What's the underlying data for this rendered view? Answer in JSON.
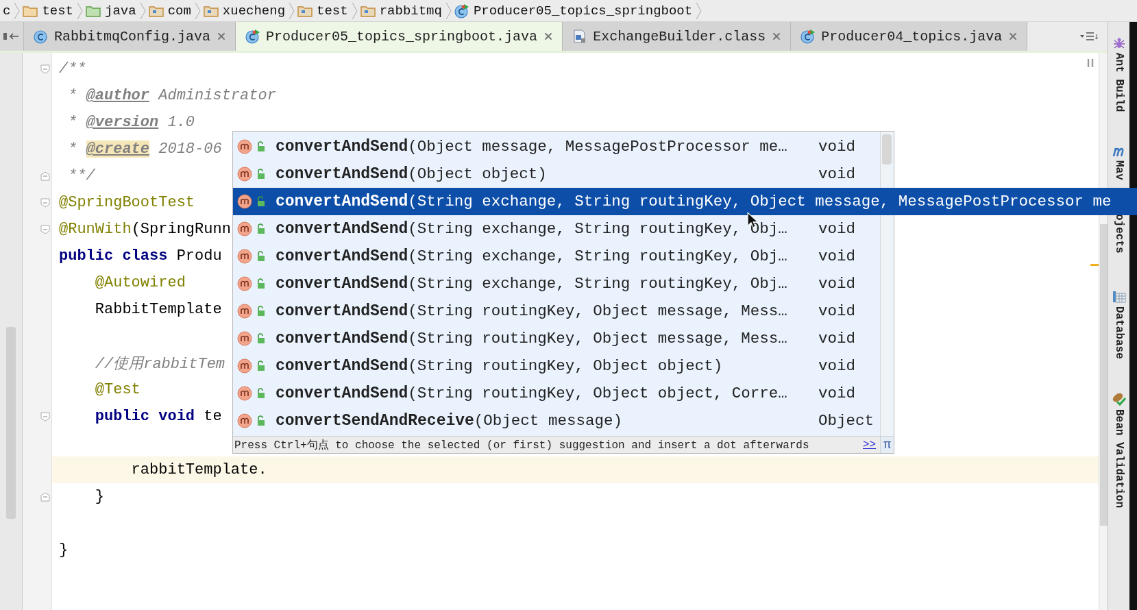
{
  "breadcrumbs": [
    {
      "label": "c",
      "kind": "none"
    },
    {
      "label": "test",
      "kind": "folder"
    },
    {
      "label": "java",
      "kind": "source"
    },
    {
      "label": "com",
      "kind": "package"
    },
    {
      "label": "xuecheng",
      "kind": "package"
    },
    {
      "label": "test",
      "kind": "package"
    },
    {
      "label": "rabbitmq",
      "kind": "package"
    },
    {
      "label": "Producer05_topics_springboot",
      "kind": "runnable"
    }
  ],
  "tabs": [
    {
      "label": "RabbitmqConfig.java",
      "kind": "class",
      "selected": false
    },
    {
      "label": "Producer05_topics_springboot.java",
      "kind": "runnable",
      "selected": true
    },
    {
      "label": "ExchangeBuilder.class",
      "kind": "compiled",
      "selected": false
    },
    {
      "label": "Producer04_topics.java",
      "kind": "runnable",
      "selected": false
    }
  ],
  "code_lines": [
    {
      "kind": "code",
      "fold_start": true,
      "tokens": [
        {
          "kind": "comment",
          "text": "/**"
        }
      ]
    },
    {
      "kind": "code",
      "tokens": [
        {
          "kind": "comment",
          "text": " * "
        },
        {
          "kind": "doctag",
          "text": "@author"
        },
        {
          "kind": "comment",
          "text": " Administrator"
        }
      ]
    },
    {
      "kind": "code",
      "tokens": [
        {
          "kind": "comment",
          "text": " * "
        },
        {
          "kind": "doctag",
          "text": "@version"
        },
        {
          "kind": "comment",
          "text": " 1.0"
        }
      ]
    },
    {
      "kind": "code",
      "tokens": [
        {
          "kind": "comment",
          "text": " * "
        },
        {
          "kind": "doctag",
          "text": "@create",
          "highlighted": true
        },
        {
          "kind": "comment",
          "text": " 2018-06"
        }
      ]
    },
    {
      "kind": "code",
      "fold_end": true,
      "tokens": [
        {
          "kind": "comment",
          "text": " **/"
        }
      ]
    },
    {
      "kind": "code",
      "fold_start": true,
      "tokens": [
        {
          "kind": "annotation",
          "text": "@SpringBootTest"
        }
      ]
    },
    {
      "kind": "code",
      "fold_start": true,
      "tokens": [
        {
          "kind": "annotation",
          "text": "@RunWith"
        },
        {
          "kind": "plain",
          "text": "(SpringRunn"
        }
      ]
    },
    {
      "kind": "code",
      "tokens": [
        {
          "kind": "keyword",
          "text": "public class "
        },
        {
          "kind": "plain",
          "text": "Produ"
        }
      ]
    },
    {
      "kind": "code",
      "tokens": [
        {
          "kind": "annotation",
          "text": "    @Autowired"
        }
      ]
    },
    {
      "kind": "code",
      "tokens": [
        {
          "kind": "plain",
          "text": "    RabbitTemplate"
        }
      ]
    },
    {
      "kind": "blank"
    },
    {
      "kind": "code",
      "tokens": [
        {
          "kind": "comment",
          "text": "    //使用rabbitTem"
        }
      ]
    },
    {
      "kind": "code",
      "tokens": [
        {
          "kind": "annotation",
          "text": "    @Test"
        }
      ]
    },
    {
      "kind": "code",
      "fold_start": true,
      "tokens": [
        {
          "kind": "keyword",
          "text": "    public void "
        },
        {
          "kind": "plain",
          "text": "te"
        }
      ]
    },
    {
      "kind": "blank"
    },
    {
      "kind": "code",
      "current": true,
      "tokens": [
        {
          "kind": "plain",
          "text": "        rabbitTemplate."
        }
      ]
    },
    {
      "kind": "code",
      "fold_end": true,
      "tokens": [
        {
          "kind": "plain",
          "text": "    }"
        }
      ]
    },
    {
      "kind": "blank"
    },
    {
      "kind": "code",
      "tokens": [
        {
          "kind": "plain",
          "text": "}"
        }
      ]
    }
  ],
  "completion": {
    "items": [
      {
        "name": "convertAndSend",
        "params": "(Object message, MessagePostProcessor me…",
        "type": "void",
        "selected": false
      },
      {
        "name": "convertAndSend",
        "params": "(Object object)",
        "type": "void",
        "selected": false
      },
      {
        "name": "convertAndSend",
        "params": "(String exchange, String routingKey, Object message, MessagePostProcessor me",
        "selected": true
      },
      {
        "name": "convertAndSend",
        "params": "(String exchange, String routingKey, Obj…",
        "type": "void",
        "selected": false
      },
      {
        "name": "convertAndSend",
        "params": "(String exchange, String routingKey, Obj…",
        "type": "void",
        "selected": false
      },
      {
        "name": "convertAndSend",
        "params": "(String exchange, String routingKey, Obj…",
        "type": "void",
        "selected": false
      },
      {
        "name": "convertAndSend",
        "params": "(String routingKey, Object message, Mess…",
        "type": "void",
        "selected": false
      },
      {
        "name": "convertAndSend",
        "params": "(String routingKey, Object message, Mess…",
        "type": "void",
        "selected": false
      },
      {
        "name": "convertAndSend",
        "params": "(String routingKey, Object object)",
        "type": "void",
        "selected": false
      },
      {
        "name": "convertAndSend",
        "params": "(String routingKey, Object object, Corre…",
        "type": "void",
        "selected": false
      },
      {
        "name": "convertSendAndReceive",
        "params": "(Object message)",
        "type": "Object",
        "selected": false
      }
    ],
    "hint": "Press Ctrl+句点 to choose the selected (or first) suggestion and insert a dot afterwards",
    "link": ">>",
    "pi": "π"
  },
  "tool_windows": [
    {
      "label": "Ant Build",
      "kind": "ant"
    },
    {
      "label": "Mav",
      "kind": "maven"
    },
    {
      "label": "ojects",
      "kind": "text"
    },
    {
      "label": "Database",
      "kind": "database"
    },
    {
      "label": "Bean Validation",
      "kind": "bean"
    }
  ]
}
